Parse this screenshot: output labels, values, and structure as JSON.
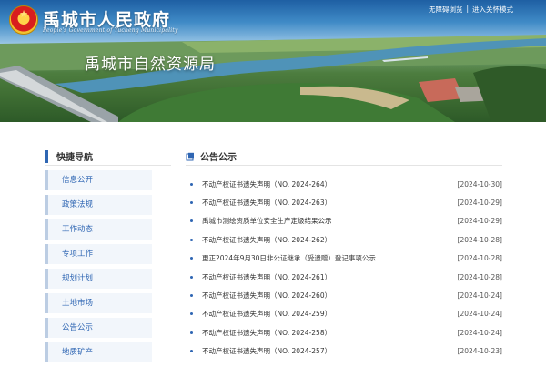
{
  "header": {
    "gov_title": "禹城市人民政府",
    "gov_subtitle": "People's Government of Yucheng Municipality",
    "dept_title": "禹城市自然资源局",
    "top_links": {
      "accessible": "无障碍浏览",
      "separator": "|",
      "elderly": "进入关怀模式"
    }
  },
  "sidebar": {
    "title": "快捷导航",
    "items": [
      "信息公开",
      "政策法规",
      "工作动态",
      "专项工作",
      "规划计划",
      "土地市场",
      "公告公示",
      "地质矿产"
    ]
  },
  "main": {
    "title": "公告公示",
    "news": [
      {
        "title": "不动产权证书遗失声明（NO. 2024-264）",
        "date": "[2024-10-30]"
      },
      {
        "title": "不动产权证书遗失声明（NO. 2024-263）",
        "date": "[2024-10-29]"
      },
      {
        "title": "禹城市测绘资质单位安全生产定级结果公示",
        "date": "[2024-10-29]"
      },
      {
        "title": "不动产权证书遗失声明（NO. 2024-262）",
        "date": "[2024-10-28]"
      },
      {
        "title": "更正2024年9月30日非公证继承（受遗赠）登记事项公示",
        "date": "[2024-10-28]"
      },
      {
        "title": "不动产权证书遗失声明（NO. 2024-261）",
        "date": "[2024-10-28]"
      },
      {
        "title": "不动产权证书遗失声明（NO. 2024-260）",
        "date": "[2024-10-24]"
      },
      {
        "title": "不动产权证书遗失声明（NO. 2024-259）",
        "date": "[2024-10-24]"
      },
      {
        "title": "不动产权证书遗失声明（NO. 2024-258）",
        "date": "[2024-10-24]"
      },
      {
        "title": "不动产权证书遗失声明（NO. 2024-257）",
        "date": "[2024-10-23]"
      }
    ]
  },
  "colors": {
    "accent": "#2f66b3",
    "side_bg": "#f2f6fb",
    "side_border": "#bccde3"
  }
}
